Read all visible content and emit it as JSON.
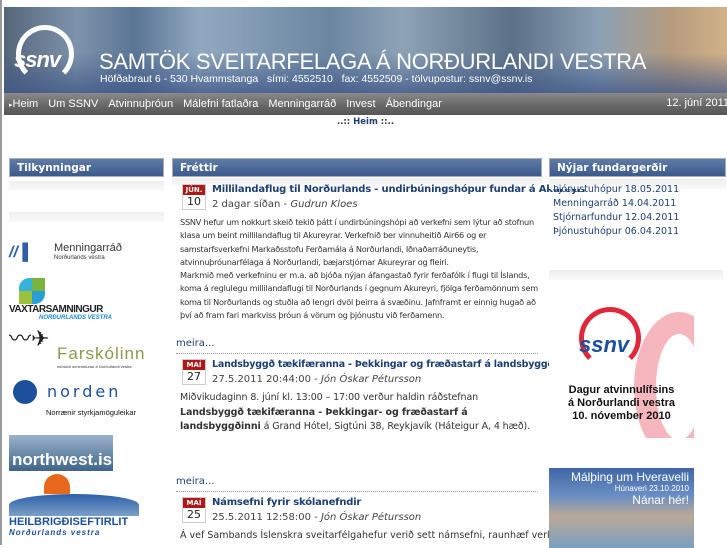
{
  "header": {
    "logo": "ssnv",
    "title": "SAMTÖK SVEITARFELAGA Á NORÐURLANDI VESTRA",
    "address": "Höfðabraut 6 - 530 Hvammstanga   sími: 4552510   fax: 4552509 - tölvupostur: ssnv@ssnv.is"
  },
  "nav": {
    "items": [
      "Heim",
      "Um SSNV",
      "Atvinnuþróun",
      "Málefni fatlaðra",
      "Menningarráð",
      "Invest",
      "Ábendingar"
    ],
    "date": "12. júní 2011"
  },
  "breadcrumb": {
    "prefix": "..:: ",
    "current": "Heim",
    "suffix": " ::.."
  },
  "left": {
    "title": "Tilkynningar",
    "logos": {
      "menningarrad": "Menningarráð",
      "menningarrad_sub": "Norðurlands vestra",
      "vaxtar": "VAXTARSAMNINGUR",
      "vaxtar_sub": "NORÐURLANDS VESTRA",
      "farskolinn": "Farskólinn",
      "farskolinn_sub": "miðstöð símenntunar á Norðurlandi vestra",
      "norden": "norden",
      "norden_sub": "Norrænir styrkjamöguleikar",
      "northwest": "northwest.is",
      "heilbrigdis": "HEILBRIGÐISEFTIRLIT",
      "heilbrigdis_sub": "Norðurlands vestra"
    }
  },
  "news": {
    "title": "Fréttir",
    "more": "meira...",
    "articles": [
      {
        "month": "JÚN.",
        "day": "10",
        "title": "Millilandaflug til Norðurlands - undirbúningshópur fundar á Akureyri",
        "date": "2 dagar síðan",
        "author": "Gudrun Kloes",
        "body": "SSNV hefur um nokkurt skeið tekið þátt í undirbúningshópi að verkefni sem lýtur að stofnun klasa um beint millilandaflug til Akureyrar.  Verkefnið ber vinnuheitið Air66 og er samstarfsverkefni Markaðsstofu Ferðamála á Norðurlandi, Iðnaðarráðuneytis, atvinnuþróunarfélaga á Norðurlandi, bæjarstjórnar Akureyrar og fleiri.",
        "body2": "Markmið með verkefninu er m.a. að bjóða nýjan  áfangastað fyrir ferðafólk í flugi til Íslands, koma á reglulegu millilandaflugi til Norðurlands í gegnum Akureyri, fjölga ferðamönnum sem koma til Norðurlands og  stuðla að lengri dvöl þeirra á svæðinu.  Jafnframt er einnig hugað að því að fram fari markviss þróun á vörum og þjónustu við ferðamenn."
      },
      {
        "month": "MAÍ",
        "day": "27",
        "title": "Landsbyggð tækifæranna - Þekkingar og fræðastarf á landsbyggðinni",
        "date": "27.5.2011 20:44:00",
        "author": "Jón Óskar Pétursson",
        "body": "Miðvikudaginn 8. júní  kl. 13:00 – 17:00 verður haldin ráðstefnan ",
        "body_bold": "Landsbyggð tækifæranna - Þekkingar- og fræðastarf á landsbyggðinni",
        "body2": " á  Grand Hótel, Sigtúni 38, Reykjavík (Háteigur A, 4 hæð)."
      },
      {
        "month": "MAÍ",
        "day": "25",
        "title": "Námsefni fyrir skólanefndir",
        "date": "25.5.2011 12:58:00",
        "author": "Jón Óskar Pétursson",
        "body": "Á vef Sambands Íslenskra sveitarfélgahefur verið sett námsefni, raunhæf verkefni"
      }
    ]
  },
  "right": {
    "title": "Nýjar fundargerðir",
    "meetings": [
      "Þjónustuhópur 18.05.2011",
      "Menningarráð 14.04.2011",
      "Stjórnarfundur 12.04.2011",
      "Þjónustuhópur 06.04.2011"
    ],
    "banner1": {
      "logo": "ssnv",
      "line1": "Dagur atvinnulífsins",
      "line2": "á Norðurlandi vestra",
      "line3": "10. nóvember 2010"
    },
    "banner2": {
      "line1": "Málþing um Hveravelli",
      "line2": "Húnaveri 23.10.2010",
      "line3": "Nánar hér!"
    }
  },
  "colors": {
    "nav": "#666666",
    "header_blue": "#3b5a8c",
    "link": "#1e3f73",
    "cal_red": "#b01818"
  }
}
